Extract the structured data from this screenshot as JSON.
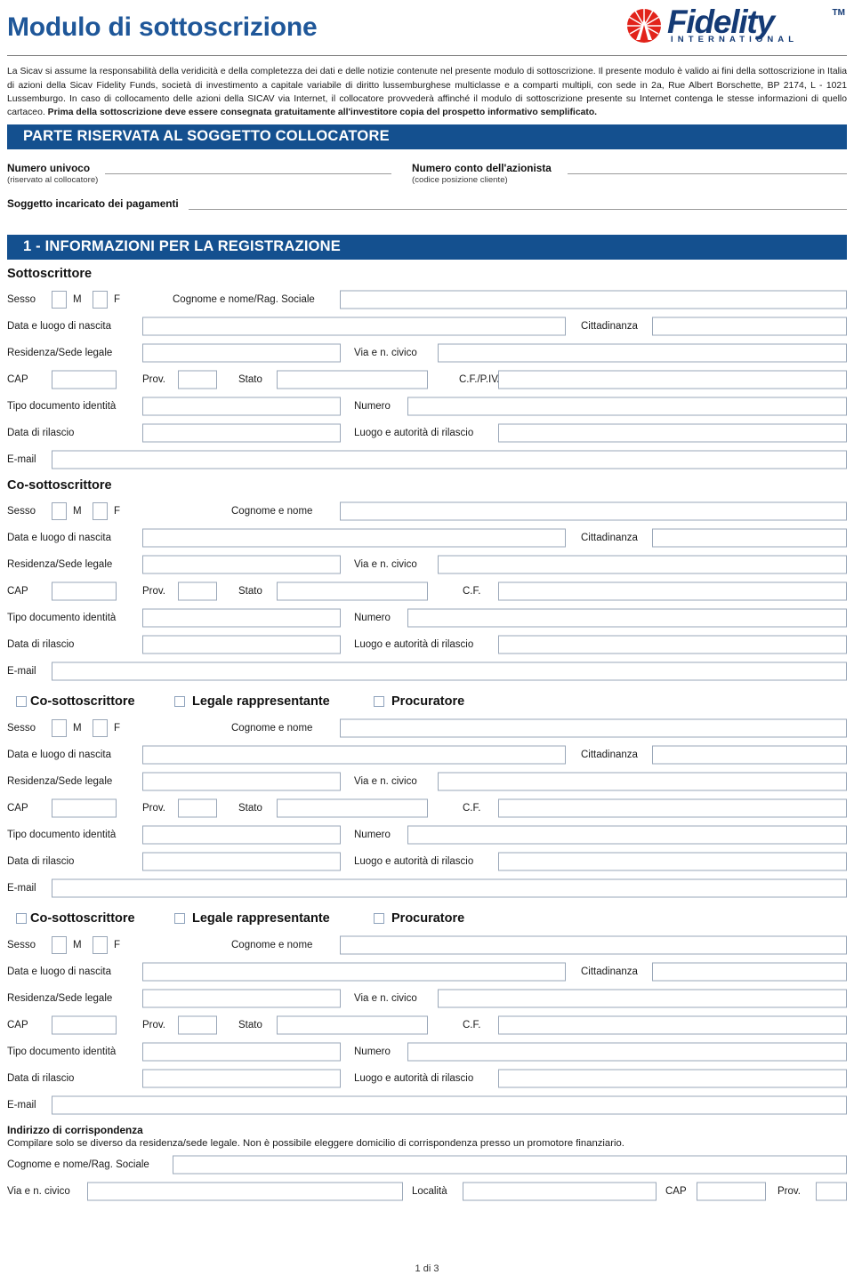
{
  "header": {
    "title": "Modulo di sottoscrizione",
    "logo": {
      "name": "Fidelity",
      "tm": "TM",
      "tagline": "INTERNATIONAL"
    }
  },
  "intro": {
    "text_part1": "La Sicav si assume la responsabilità della veridicità e della completezza dei dati e delle notizie contenute nel presente modulo di sottoscrizione. Il presente modulo è valido ai fini della sottoscrizione in Italia di azioni della Sicav Fidelity Funds, società di investimento a capitale variabile di diritto lussemburghese multiclasse e a comparti multipli, con sede in 2a, Rue Albert Borschette, BP 2174, L - 1021 Lussemburgo. In caso di collocamento delle azioni della SICAV via Internet, il collocatore provvederà affinché il modulo di sottoscrizione presente su Internet contenga le stesse informazioni di quello cartaceo. ",
    "text_bold": "Prima della sottoscrizione deve essere consegnata gratuitamente all'investitore copia del prospetto informativo semplificato."
  },
  "sections": {
    "collocatore_bar": "PARTE RISERVATA AL SOGGETTO COLLOCATORE",
    "registrazione_bar": "1 - INFORMAZIONI PER LA REGISTRAZIONE"
  },
  "collocatore": {
    "numero_univoco_label": "Numero univoco",
    "numero_univoco_note": "(riservato al collocatore)",
    "numero_conto_label": "Numero conto dell'azionista",
    "numero_conto_note": "(codice posizione cliente)",
    "soggetto_pagamenti_label": "Soggetto incaricato dei pagamenti"
  },
  "labels": {
    "sesso": "Sesso",
    "m": "M",
    "f": "F",
    "cognome_rag_sociale": "Cognome e nome/Rag. Sociale",
    "cognome_nome": "Cognome e nome",
    "data_luogo_nascita": "Data e luogo di nascita",
    "cittadinanza": "Cittadinanza",
    "residenza_sede": "Residenza/Sede legale",
    "via_civico": "Via e n. civico",
    "cap": "CAP",
    "prov": "Prov.",
    "stato": "Stato",
    "cf_piva": "C.F./P.IVA",
    "cf": "C.F.",
    "tipo_documento": "Tipo documento identità",
    "numero": "Numero",
    "data_rilascio": "Data di rilascio",
    "luogo_autorita": "Luogo e autorità di rilascio",
    "email": "E-mail",
    "localita": "Località"
  },
  "persons": [
    {
      "id": "sottoscrittore",
      "heading": "Sottoscrittore",
      "name_label": "Cognome e nome/Rag. Sociale",
      "cf_label": "C.F./P.IVA",
      "has_roles": false
    },
    {
      "id": "co-sottoscrittore",
      "heading": "Co-sottoscrittore",
      "name_label": "Cognome e nome",
      "cf_label": "C.F.",
      "has_roles": false
    },
    {
      "id": "rappresentante-1",
      "heading": "",
      "name_label": "Cognome e nome",
      "cf_label": "C.F.",
      "has_roles": true
    },
    {
      "id": "rappresentante-2",
      "heading": "",
      "name_label": "Cognome e nome",
      "cf_label": "C.F.",
      "has_roles": true
    }
  ],
  "roles": {
    "co_sottoscrittore": "Co-sottoscrittore",
    "legale_rappresentante": "Legale rappresentante",
    "procuratore": "Procuratore"
  },
  "correspondence": {
    "title": "Indirizzo di corrispondenza",
    "note": "Compilare solo se diverso da residenza/sede legale. Non è possibile eleggere domicilio di corrispondenza presso un promotore finanziario.",
    "cognome_label": "Cognome e nome/Rag. Sociale",
    "via_label": "Via e n. civico",
    "localita_label": "Località",
    "cap_label": "CAP",
    "prov_label": "Prov."
  },
  "footer": {
    "page": "1 di 3"
  },
  "colors": {
    "brand_blue": "#14508f",
    "title_blue": "#1f5799",
    "logo_red": "#e2231a",
    "field_border": "#9aa7b8"
  }
}
